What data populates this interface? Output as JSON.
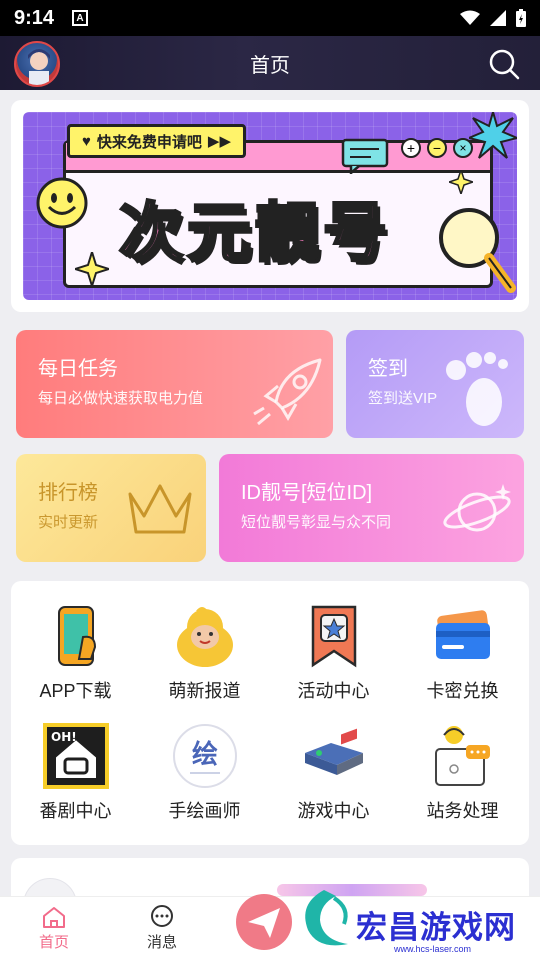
{
  "status_bar": {
    "time": "9:14",
    "notice_letter": "A"
  },
  "header": {
    "title": "首页"
  },
  "banner": {
    "tag": "快来免费申请吧",
    "headline": "次元靓号"
  },
  "tiles": {
    "daily_task": {
      "title": "每日任务",
      "subtitle": "每日必做快速获取电力值"
    },
    "sign_in": {
      "title": "签到",
      "subtitle": "签到送VIP"
    },
    "ranking": {
      "title": "排行榜",
      "subtitle": "实时更新"
    },
    "id_number": {
      "title": "ID靓号[短位ID]",
      "subtitle": "短位靓号彰显与众不同"
    }
  },
  "grid": [
    {
      "label": "APP下载",
      "icon": "phone-icon"
    },
    {
      "label": "萌新报道",
      "icon": "duck-icon"
    },
    {
      "label": "活动中心",
      "icon": "star-bookmark-icon"
    },
    {
      "label": "卡密兑换",
      "icon": "card-icon"
    },
    {
      "label": "番剧中心",
      "icon": "house-icon",
      "badge": "OH!"
    },
    {
      "label": "手绘画师",
      "icon": "draw-icon",
      "badge": "绘"
    },
    {
      "label": "游戏中心",
      "icon": "gamepad-icon"
    },
    {
      "label": "站务处理",
      "icon": "support-icon"
    }
  ],
  "tabs": [
    {
      "label": "首页",
      "icon": "home-icon",
      "active": true
    },
    {
      "label": "消息",
      "icon": "message-icon",
      "active": false
    }
  ],
  "watermark": {
    "text": "宏昌游戏网",
    "url": "www.hcs-laser.com"
  },
  "colors": {
    "accent": "#f26b8a",
    "appbar": "#1d1a33"
  }
}
